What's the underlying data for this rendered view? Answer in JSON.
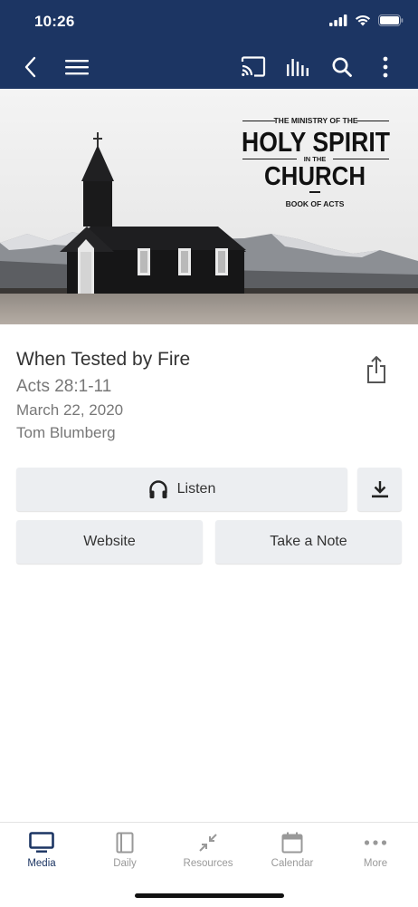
{
  "status_bar": {
    "time": "10:26"
  },
  "top_bar": {
    "icons": [
      "back-icon",
      "menu-icon",
      "cast-icon",
      "audio-bars-icon",
      "search-icon",
      "more-vertical-icon"
    ]
  },
  "hero": {
    "line1": "THE MINISTRY OF THE",
    "line2": "HOLY SPIRIT",
    "line3": "IN THE",
    "line4": "CHURCH",
    "line5": "BOOK OF ACTS"
  },
  "sermon": {
    "title": "When Tested by Fire",
    "passage": "Acts 28:1-11",
    "date": "March 22, 2020",
    "speaker": "Tom Blumberg"
  },
  "actions": {
    "listen": "Listen",
    "website": "Website",
    "note": "Take a Note"
  },
  "tabs": [
    {
      "label": "Media",
      "icon": "tv-icon",
      "active": true
    },
    {
      "label": "Daily",
      "icon": "book-icon",
      "active": false
    },
    {
      "label": "Resources",
      "icon": "compress-arrows-icon",
      "active": false
    },
    {
      "label": "Calendar",
      "icon": "calendar-icon",
      "active": false
    },
    {
      "label": "More",
      "icon": "dots-icon",
      "active": false
    }
  ],
  "colors": {
    "navy": "#1c3563",
    "button_bg": "#eceef1",
    "muted_text": "#777777"
  }
}
